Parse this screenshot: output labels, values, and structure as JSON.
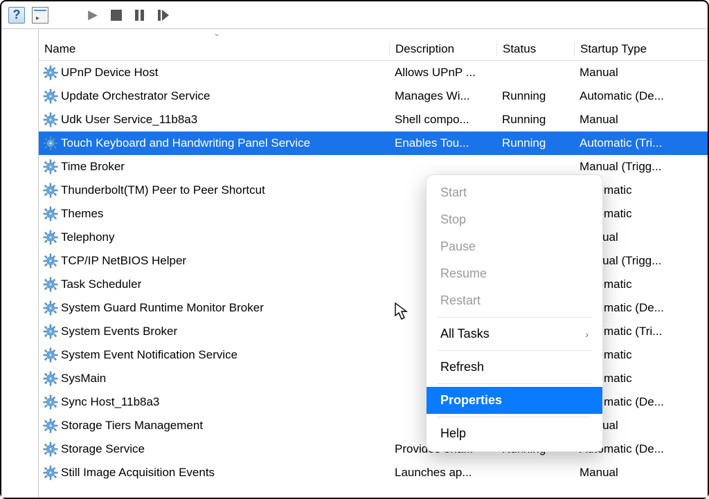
{
  "toolbar": {
    "help_tooltip": "Help",
    "panel_tooltip": "Show/Hide Action Pane"
  },
  "headers": {
    "name": "Name",
    "description": "Description",
    "status": "Status",
    "startup": "Startup Type"
  },
  "services": [
    {
      "name": "UPnP Device Host",
      "desc": "Allows UPnP ...",
      "status": "",
      "startup": "Manual",
      "selected": false
    },
    {
      "name": "Update Orchestrator Service",
      "desc": "Manages Wi...",
      "status": "Running",
      "startup": "Automatic (De...",
      "selected": false
    },
    {
      "name": "Udk User Service_11b8a3",
      "desc": "Shell compo...",
      "status": "Running",
      "startup": "Manual",
      "selected": false
    },
    {
      "name": "Touch Keyboard and Handwriting Panel Service",
      "desc": "Enables Tou...",
      "status": "Running",
      "startup": "Automatic (Tri...",
      "selected": true
    },
    {
      "name": "Time Broker",
      "desc": "",
      "status": "",
      "startup": "Manual (Trigg...",
      "selected": false
    },
    {
      "name": "Thunderbolt(TM) Peer to Peer Shortcut",
      "desc": "",
      "status": "",
      "startup": "Automatic",
      "selected": false
    },
    {
      "name": "Themes",
      "desc": "",
      "status": "",
      "startup": "Automatic",
      "selected": false
    },
    {
      "name": "Telephony",
      "desc": "",
      "status": "",
      "startup": "Manual",
      "selected": false
    },
    {
      "name": "TCP/IP NetBIOS Helper",
      "desc": "",
      "status": "",
      "startup": "Manual (Trigg...",
      "selected": false
    },
    {
      "name": "Task Scheduler",
      "desc": "",
      "status": "",
      "startup": "Automatic",
      "selected": false
    },
    {
      "name": "System Guard Runtime Monitor Broker",
      "desc": "",
      "status": "",
      "startup": "Automatic (De...",
      "selected": false
    },
    {
      "name": "System Events Broker",
      "desc": "",
      "status": "",
      "startup": "Automatic (Tri...",
      "selected": false
    },
    {
      "name": "System Event Notification Service",
      "desc": "",
      "status": "",
      "startup": "Automatic",
      "selected": false
    },
    {
      "name": "SysMain",
      "desc": "",
      "status": "",
      "startup": "Automatic",
      "selected": false
    },
    {
      "name": "Sync Host_11b8a3",
      "desc": "",
      "status": "",
      "startup": "Automatic (De...",
      "selected": false
    },
    {
      "name": "Storage Tiers Management",
      "desc": "",
      "status": "",
      "startup": "Manual",
      "selected": false
    },
    {
      "name": "Storage Service",
      "desc": "Provides ena...",
      "status": "Running",
      "startup": "Automatic (De...",
      "selected": false
    },
    {
      "name": "Still Image Acquisition Events",
      "desc": "Launches ap...",
      "status": "",
      "startup": "Manual",
      "selected": false
    }
  ],
  "context_menu": {
    "items": [
      {
        "label": "Start",
        "type": "item",
        "disabled": true
      },
      {
        "label": "Stop",
        "type": "item",
        "disabled": true
      },
      {
        "label": "Pause",
        "type": "item",
        "disabled": true
      },
      {
        "label": "Resume",
        "type": "item",
        "disabled": true
      },
      {
        "label": "Restart",
        "type": "item",
        "disabled": true
      },
      {
        "type": "sep"
      },
      {
        "label": "All Tasks",
        "type": "submenu",
        "disabled": false
      },
      {
        "type": "sep"
      },
      {
        "label": "Refresh",
        "type": "item",
        "disabled": false
      },
      {
        "type": "sep"
      },
      {
        "label": "Properties",
        "type": "item",
        "disabled": false,
        "highlighted": true
      },
      {
        "type": "sep"
      },
      {
        "label": "Help",
        "type": "item",
        "disabled": false
      }
    ]
  }
}
